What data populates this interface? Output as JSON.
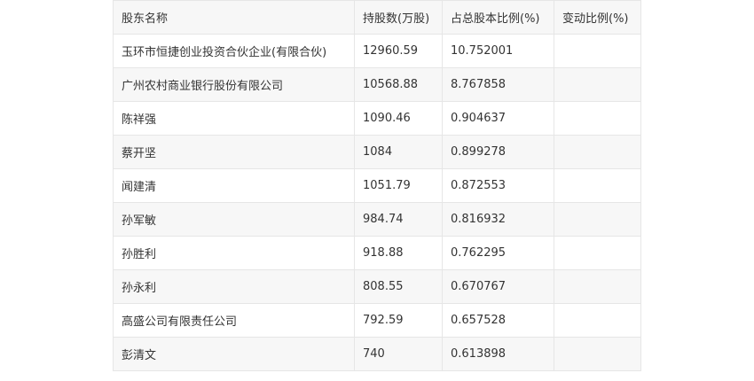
{
  "table": {
    "headers": [
      "股东名称",
      "持股数(万股)",
      "占总股本比例(%)",
      "变动比例(%)"
    ],
    "rows": [
      [
        "玉环市恒捷创业投资合伙企业(有限合伙)",
        "12960.59",
        "10.752001",
        ""
      ],
      [
        "广州农村商业银行股份有限公司",
        "10568.88",
        "8.767858",
        ""
      ],
      [
        "陈祥强",
        "1090.46",
        "0.904637",
        ""
      ],
      [
        "蔡开坚",
        "1084",
        "0.899278",
        ""
      ],
      [
        "闻建清",
        "1051.79",
        "0.872553",
        ""
      ],
      [
        "孙军敏",
        "984.74",
        "0.816932",
        ""
      ],
      [
        "孙胜利",
        "918.88",
        "0.762295",
        ""
      ],
      [
        "孙永利",
        "808.55",
        "0.670767",
        ""
      ],
      [
        "高盛公司有限责任公司",
        "792.59",
        "0.657528",
        ""
      ],
      [
        "彭清文",
        "740",
        "0.613898",
        ""
      ]
    ]
  }
}
